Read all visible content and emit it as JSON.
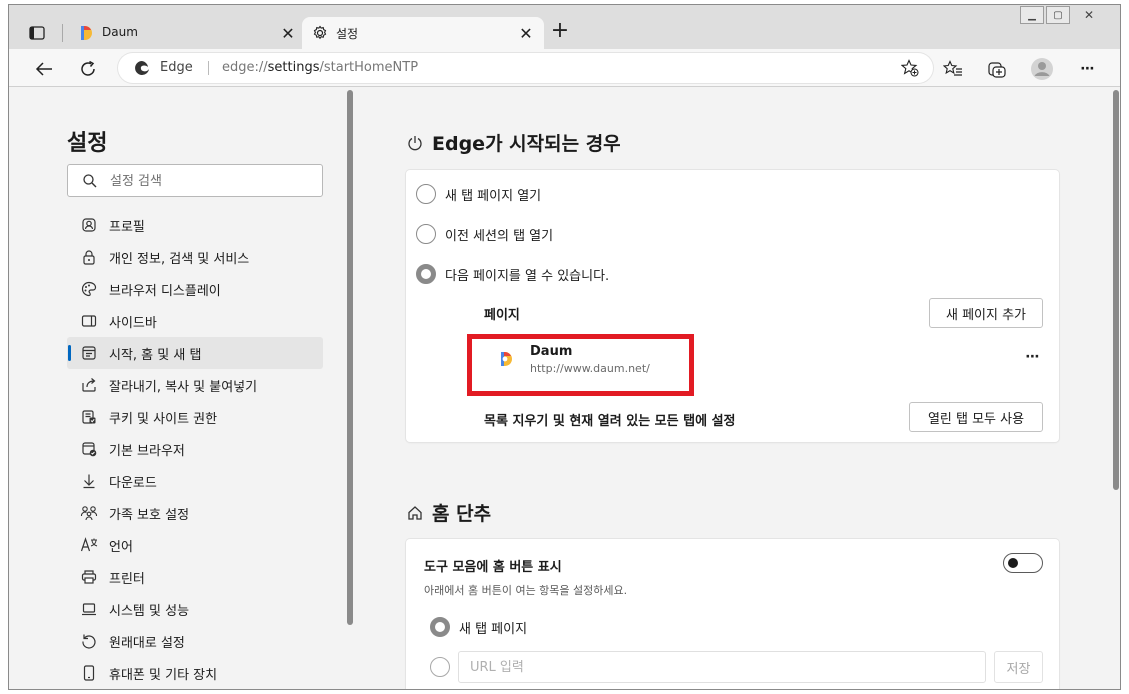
{
  "browser": {
    "tabs": [
      {
        "title": "Daum",
        "icon": "daum-favicon"
      },
      {
        "title": "설정",
        "icon": "gear-icon"
      }
    ],
    "address": {
      "edge_label": "Edge",
      "url_scheme": "edge://",
      "url_host": "settings",
      "url_path": "/startHomeNTP"
    }
  },
  "sidebar": {
    "title": "설정",
    "search_placeholder": "설정 검색",
    "items": [
      {
        "label": "프로필",
        "icon": "profile-icon"
      },
      {
        "label": "개인 정보, 검색 및 서비스",
        "icon": "lock-icon"
      },
      {
        "label": "브라우저 디스플레이",
        "icon": "palette-icon"
      },
      {
        "label": "사이드바",
        "icon": "sidebar-icon"
      },
      {
        "label": "시작, 홈 및 새 탭",
        "icon": "start-home-icon",
        "selected": true
      },
      {
        "label": "잘라내기, 복사 및 붙여넣기",
        "icon": "share-icon"
      },
      {
        "label": "쿠키 및 사이트 권한",
        "icon": "cookie-icon"
      },
      {
        "label": "기본 브라우저",
        "icon": "default-browser-icon"
      },
      {
        "label": "다운로드",
        "icon": "download-icon"
      },
      {
        "label": "가족 보호 설정",
        "icon": "family-icon"
      },
      {
        "label": "언어",
        "icon": "language-icon"
      },
      {
        "label": "프린터",
        "icon": "printer-icon"
      },
      {
        "label": "시스템 및 성능",
        "icon": "laptop-icon"
      },
      {
        "label": "원래대로 설정",
        "icon": "reset-icon"
      },
      {
        "label": "휴대폰 및 기타 장치",
        "icon": "phone-icon"
      }
    ]
  },
  "startup": {
    "title": "Edge가 시작되는 경우",
    "options": [
      {
        "label": "새 탭 페이지 열기",
        "checked": false
      },
      {
        "label": "이전 세션의 탭 열기",
        "checked": false
      },
      {
        "label": "다음 페이지를 열 수 있습니다.",
        "checked": true
      }
    ],
    "pages_label": "페이지",
    "add_page_button": "새 페이지 추가",
    "page": {
      "title": "Daum",
      "url": "http://www.daum.net/"
    },
    "more_label": "⋯",
    "clear_label": "목록 지우기 및 현재 열려 있는 모든 탭에 설정",
    "use_all_tabs_button": "열린 탭 모두 사용",
    "highlight_color": "#e21b23"
  },
  "home": {
    "title": "홈 단추",
    "show_button_label": "도구 모음에 홈 버튼 표시",
    "description": "아래에서 홈 버튼이 여는 항목을 설정하세요.",
    "toggle_on": false,
    "option_new_tab": "새 탭 페이지",
    "url_placeholder": "URL 입력",
    "save_button": "저장"
  },
  "colors": {
    "accent": "#0067c0",
    "daum_blue": "#4a86e8",
    "daum_red": "#e7473c",
    "daum_yellow": "#f6b936"
  }
}
